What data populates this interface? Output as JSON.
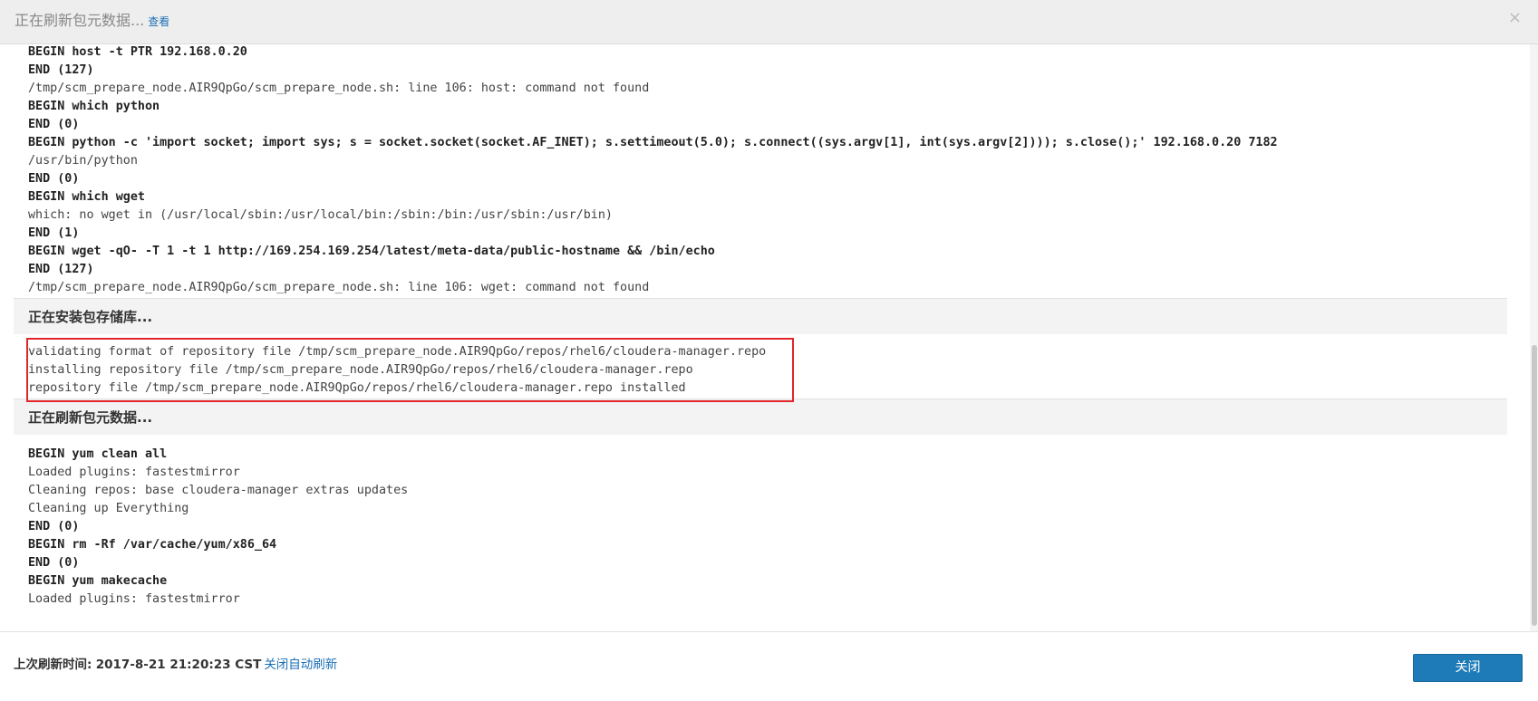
{
  "header": {
    "title": "正在刷新包元数据...",
    "view_link": "查看",
    "close_glyph": "×"
  },
  "log": {
    "top_lines": [
      {
        "text": "BEGIN host -t PTR 192.168.0.20",
        "bold": true
      },
      {
        "text": "END (127)",
        "bold": true
      },
      {
        "text": "/tmp/scm_prepare_node.AIR9QpGo/scm_prepare_node.sh: line 106: host: command not found",
        "bold": false
      },
      {
        "text": "BEGIN which python",
        "bold": true
      },
      {
        "text": "END (0)",
        "bold": true
      },
      {
        "text": "BEGIN python -c 'import socket; import sys; s = socket.socket(socket.AF_INET); s.settimeout(5.0); s.connect((sys.argv[1], int(sys.argv[2]))); s.close();' 192.168.0.20 7182",
        "bold": true
      },
      {
        "text": "/usr/bin/python",
        "bold": false
      },
      {
        "text": "END (0)",
        "bold": true
      },
      {
        "text": "BEGIN which wget",
        "bold": true
      },
      {
        "text": "which: no wget in (/usr/local/sbin:/usr/local/bin:/sbin:/bin:/usr/sbin:/usr/bin)",
        "bold": false
      },
      {
        "text": "END (1)",
        "bold": true
      },
      {
        "text": "BEGIN wget -qO- -T 1 -t 1 http://169.254.169.254/latest/meta-data/public-hostname && /bin/echo",
        "bold": true
      },
      {
        "text": "END (127)",
        "bold": true
      },
      {
        "text": "/tmp/scm_prepare_node.AIR9QpGo/scm_prepare_node.sh: line 106: wget: command not found",
        "bold": false
      }
    ],
    "section_repo": "正在安装包存储库...",
    "repo_lines": [
      {
        "text": "validating format of repository file /tmp/scm_prepare_node.AIR9QpGo/repos/rhel6/cloudera-manager.repo",
        "bold": false
      },
      {
        "text": "installing repository file /tmp/scm_prepare_node.AIR9QpGo/repos/rhel6/cloudera-manager.repo",
        "bold": false
      },
      {
        "text": "repository file /tmp/scm_prepare_node.AIR9QpGo/repos/rhel6/cloudera-manager.repo installed",
        "bold": false
      }
    ],
    "section_refresh": "正在刷新包元数据...",
    "refresh_lines": [
      {
        "text": "BEGIN yum clean all",
        "bold": true
      },
      {
        "text": "Loaded plugins: fastestmirror",
        "bold": false
      },
      {
        "text": "Cleaning repos: base cloudera-manager extras updates",
        "bold": false
      },
      {
        "text": "Cleaning up Everything",
        "bold": false
      },
      {
        "text": "END (0)",
        "bold": true
      },
      {
        "text": "BEGIN rm -Rf /var/cache/yum/x86_64",
        "bold": true
      },
      {
        "text": "END (0)",
        "bold": true
      },
      {
        "text": "BEGIN yum makecache",
        "bold": true
      },
      {
        "text": "Loaded plugins: fastestmirror",
        "bold": false
      }
    ]
  },
  "footer": {
    "last_refresh_label": "上次刷新时间:",
    "timestamp": "2017-8-21 21:20:23 CST",
    "disable_auto_refresh_link": "关闭自动刷新",
    "close_button_label": "关闭"
  },
  "colors": {
    "highlight_border": "#e0262b",
    "primary_button": "#1e7bb8",
    "link": "#1a6fb5"
  }
}
